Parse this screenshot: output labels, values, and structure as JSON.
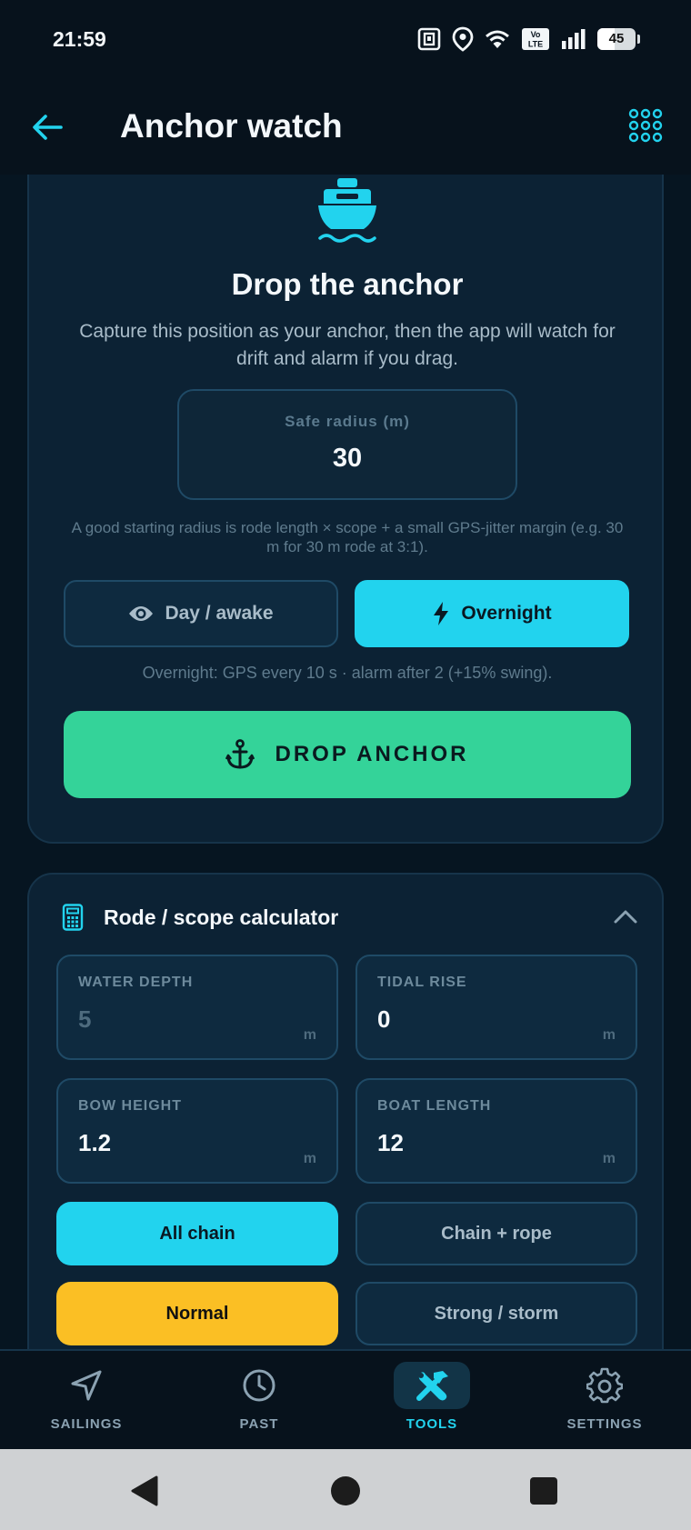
{
  "status_bar": {
    "time": "21:59",
    "network": "VoLTE",
    "battery": "45",
    "icons": [
      "nfc-icon",
      "location-icon",
      "wifi-icon",
      "volte-icon",
      "signal-icon",
      "battery-icon"
    ]
  },
  "app_bar": {
    "title": "Anchor watch",
    "back_icon": "arrow-left-icon",
    "menu_icon": "grid-dots-icon"
  },
  "anchor_card": {
    "icon": "boat-icon",
    "title": "Drop the anchor",
    "description": "Capture this position as your anchor, then the app will watch for drift and alarm if you drag.",
    "radius_label": "Safe radius (m)",
    "radius_value": "30",
    "radius_hint": "A good starting radius is rode length × scope + a small GPS-jitter margin (e.g. 30 m for 30 m rode at 3:1).",
    "modes": [
      {
        "label": "Day / awake",
        "icon": "eye-icon",
        "selected": false
      },
      {
        "label": "Overnight",
        "icon": "lightning-icon",
        "selected": true
      }
    ],
    "mode_hint": "Overnight: GPS every 10 s · alarm after 2 (+15% swing).",
    "drop_button": "DROP ANCHOR",
    "drop_icon": "anchor-icon"
  },
  "calculator": {
    "title": "Rode / scope calculator",
    "icon": "calculator-icon",
    "collapse_icon": "chevron-up-icon",
    "fields": [
      {
        "label": "WATER DEPTH",
        "value": "5",
        "unit": "m",
        "placeholder": true
      },
      {
        "label": "TIDAL RISE",
        "value": "0",
        "unit": "m",
        "placeholder": false
      },
      {
        "label": "BOW HEIGHT",
        "value": "1.2",
        "unit": "m",
        "placeholder": false
      },
      {
        "label": "BOAT LENGTH",
        "value": "12",
        "unit": "m",
        "placeholder": false
      }
    ],
    "rode_options": [
      {
        "label": "All chain",
        "selected": true
      },
      {
        "label": "Chain + rope",
        "selected": false
      }
    ],
    "condition_options": [
      {
        "label": "Normal",
        "selected": true
      },
      {
        "label": "Strong / storm",
        "selected": false
      }
    ]
  },
  "bottom_nav": {
    "items": [
      {
        "label": "SAILINGS",
        "icon": "navigation-arrow-icon",
        "active": false
      },
      {
        "label": "PAST",
        "icon": "clock-icon",
        "active": false
      },
      {
        "label": "TOOLS",
        "icon": "tools-icon",
        "active": true
      },
      {
        "label": "SETTINGS",
        "icon": "gear-icon",
        "active": false
      }
    ]
  },
  "colors": {
    "background": "#061521",
    "card": "#0c2234",
    "accent_cyan": "#22d3ee",
    "accent_green": "#34d399",
    "accent_amber": "#fbbf24"
  }
}
